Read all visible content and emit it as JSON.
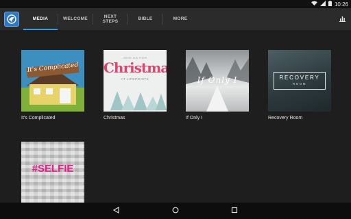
{
  "status_bar": {
    "time": "10:26",
    "icons": [
      "wifi-icon",
      "signal-icon",
      "battery-icon"
    ]
  },
  "app_bar": {
    "logo": "lifepointe-logo",
    "tabs": [
      {
        "label": "MEDIA",
        "active": true
      },
      {
        "label": "WELCOME",
        "active": false
      },
      {
        "label": "NEXT STEPS",
        "active": false
      },
      {
        "label": "BIBLE",
        "active": false
      },
      {
        "label": "MORE",
        "active": false
      }
    ],
    "action_icon": "bar-chart-icon"
  },
  "media": {
    "items": [
      {
        "title": "It's Complicated",
        "art_text": "It's Complicated"
      },
      {
        "title": "Christmas",
        "art_text": "Christmas",
        "art_sub_top": "JOIN US FOR",
        "art_sub_bottom": "AT LIFEPOINTE"
      },
      {
        "title": "If Only I",
        "art_text": "If Only I"
      },
      {
        "title": "Recovery Room",
        "art_text": "RECOVERY",
        "art_sub": "ROOM"
      },
      {
        "title": "",
        "art_text": "#SELFIE"
      }
    ]
  },
  "nav_bar": {
    "buttons": [
      "back-icon",
      "home-icon",
      "recents-icon"
    ]
  },
  "colors": {
    "accent": "#3b9be0",
    "background": "#1e1e1e",
    "app_bar": "#2b2b2b",
    "selfie_pink": "#e81d8c"
  }
}
